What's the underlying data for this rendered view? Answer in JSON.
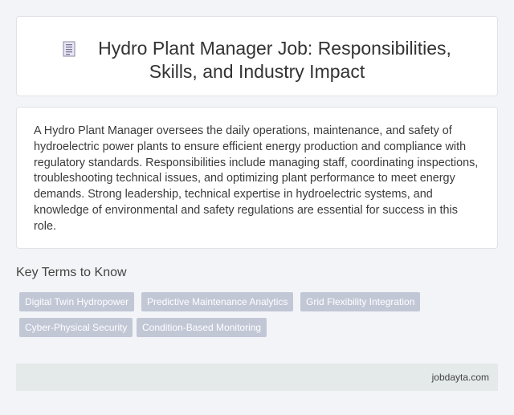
{
  "header": {
    "icon": "document-icon",
    "title_line1": "Hydro Plant Manager Job: Responsibilities,",
    "title_line2": "Skills, and Industry Impact"
  },
  "intro": {
    "text": "A Hydro Plant Manager oversees the daily operations, maintenance, and safety of hydroelectric power plants to ensure efficient energy production and compliance with regulatory standards. Responsibilities include managing staff, coordinating inspections, troubleshooting technical issues, and optimizing plant performance to meet energy demands. Strong leadership, technical expertise in hydroelectric systems, and knowledge of environmental and safety regulations are essential for success in this role."
  },
  "key_terms": {
    "title": "Key Terms to Know",
    "tags": [
      "Digital Twin Hydropower",
      "Predictive Maintenance Analytics",
      "Grid Flexibility Integration",
      "Cyber-Physical Security",
      "Condition-Based Monitoring"
    ]
  },
  "footer": {
    "site": "jobdayta.com"
  },
  "colors": {
    "background": "#f3f4f7",
    "tag_bg": "#c2c7d6",
    "footer_bg": "#e4e9ea"
  }
}
